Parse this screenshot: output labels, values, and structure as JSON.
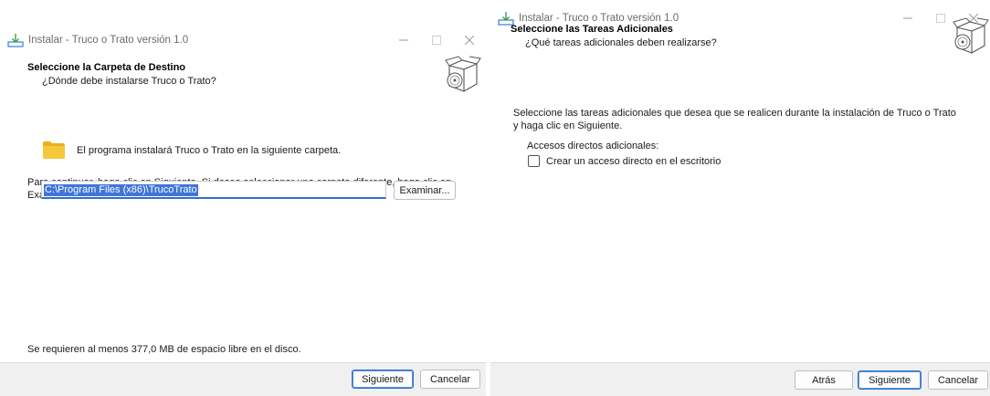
{
  "left_window": {
    "title": "Instalar - Truco o Trato versión 1.0",
    "header_title": "Seleccione la Carpeta de Destino",
    "header_subtitle": "¿Dónde debe instalarse Truco o Trato?",
    "folder_message": "El programa instalará Truco o Trato en la siguiente carpeta.",
    "instruction_line1": "Para continuar, haga clic en Siguiente. Si desea seleccionar una carpeta diferente, haga clic en",
    "instruction_line2": "Examinar.",
    "path_value": "C:\\Program Files (x86)\\TrucoTrato",
    "browse_label": "Examinar...",
    "space_required": "Se requieren al menos 377,0 MB de espacio libre en el disco.",
    "next_label": "Siguiente",
    "cancel_label": "Cancelar"
  },
  "right_window": {
    "title": "Instalar - Truco o Trato versión 1.0",
    "header_title": "Seleccione las Tareas Adicionales",
    "header_subtitle": "¿Qué tareas adicionales deben realizarse?",
    "description_line1": "Seleccione las tareas adicionales que desea que se realicen durante la instalación de Truco o Trato",
    "description_line2": "y haga clic en Siguiente.",
    "group_label": "Accesos directos adicionales:",
    "checkbox_label": "Crear un acceso directo en el escritorio",
    "checkbox_checked": false,
    "back_label": "Atrás",
    "next_label": "Siguiente",
    "cancel_label": "Cancelar"
  },
  "icons": {
    "app": "installer-icon",
    "setup": "setup-box-disc-icon",
    "folder": "folder-icon",
    "minimize": "minimize-icon",
    "maximize": "maximize-icon",
    "close": "close-icon"
  },
  "colors": {
    "accent": "#2d6fcf",
    "selection": "#3f75d8",
    "folder": "#f4c430",
    "footer_bg": "#f0f0f0"
  }
}
